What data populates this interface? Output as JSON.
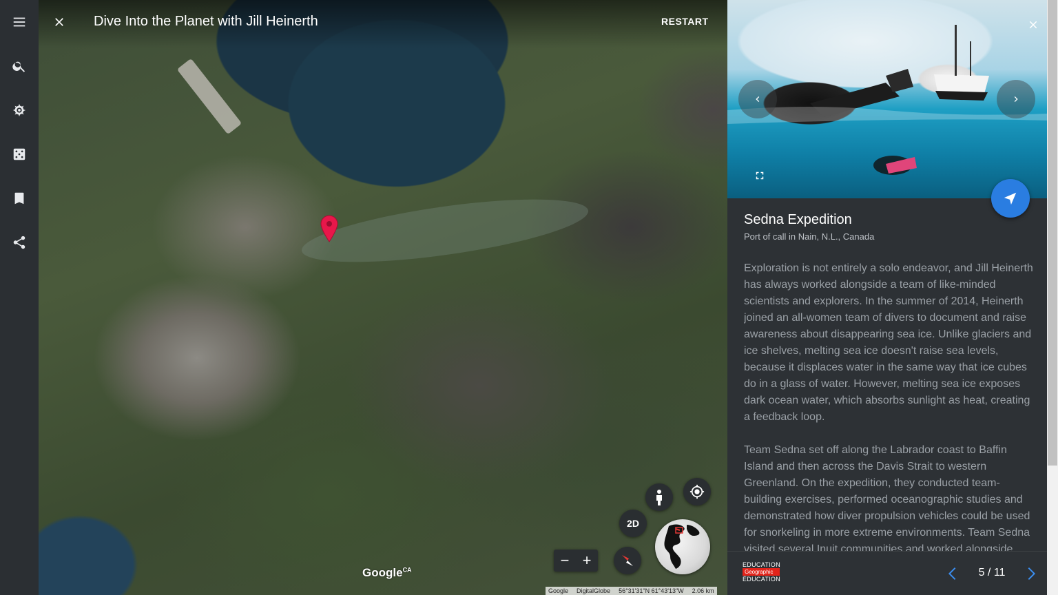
{
  "rail": {
    "items": [
      {
        "name": "menu-icon"
      },
      {
        "name": "search-icon"
      },
      {
        "name": "voyager-icon"
      },
      {
        "name": "feeling-lucky-icon"
      },
      {
        "name": "bookmark-icon"
      },
      {
        "name": "share-icon"
      }
    ]
  },
  "tour": {
    "title": "Dive Into the Planet with Jill Heinerth",
    "restart_label": "RESTART"
  },
  "map_controls": {
    "mode_label": "2D",
    "zoom_out": "−",
    "zoom_in": "+",
    "logo": "Google",
    "logo_country": "CA",
    "attribution": {
      "source1": "Google",
      "source2": "DigitalGlobe",
      "coords": "56°31'31\"N 61°43'13\"W",
      "scale": "2.06 km"
    }
  },
  "panel": {
    "title": "Sedna Expedition",
    "subtitle": "Port of call in Nain, N.L., Canada",
    "paragraphs": [
      "Exploration is not entirely a solo endeavor, and Jill Heinerth has always worked alongside a team of like-minded scientists and explorers. In the summer of 2014, Heinerth joined an all-women team of divers to document and raise awareness about disappearing sea ice. Unlike glaciers and ice shelves, melting sea ice doesn't raise sea levels, because it displaces water in the same way that ice cubes do in a glass of water. However, melting sea ice exposes dark ocean water, which absorbs sunlight as heat, creating a feedback loop.",
      "Team Sedna set off along the Labrador coast to Baffin Island and then across the Davis Strait to western Greenland. On the expedition, they conducted team-building exercises, performed oceanographic studies and demonstrated how diver propulsion vehicles could be used for snorkeling in more extreme environments. Team Sedna visited several Inuit communities and worked alongside"
    ],
    "logo": {
      "line1": "EDUCATION",
      "line2": "Geographic",
      "line3": "ÉDUCATION"
    },
    "pager": "5 / 11"
  },
  "colors": {
    "accent": "#2a7de1",
    "pin": "#e8174a",
    "panel_bg": "#2d3135",
    "rail_bg": "#2b2f33"
  }
}
